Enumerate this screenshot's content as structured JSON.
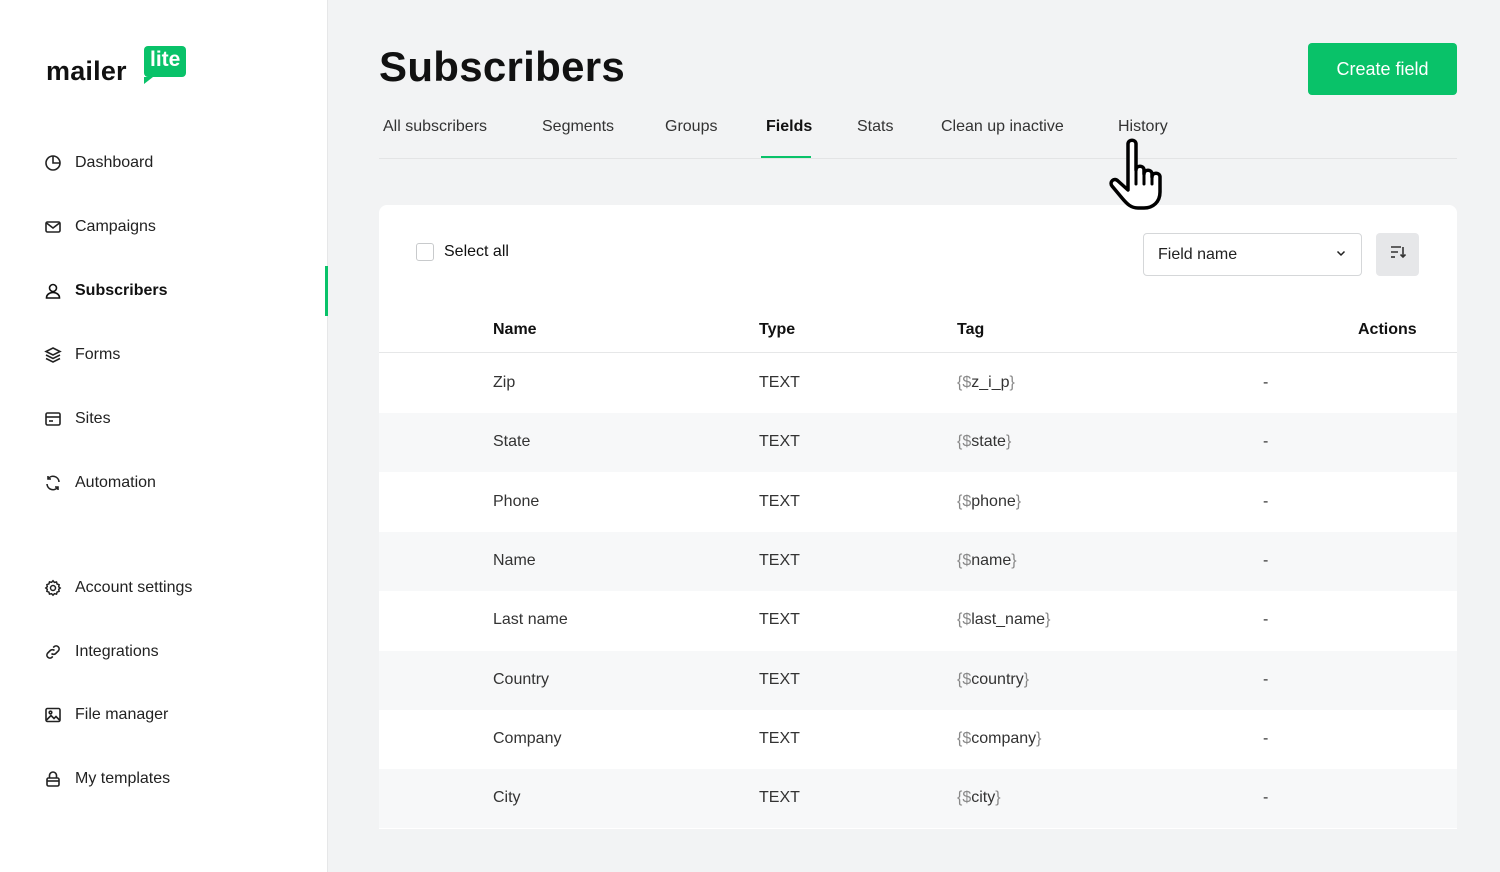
{
  "logo": {
    "part1": "mailer",
    "part2": "lite"
  },
  "sidebar": {
    "items": [
      {
        "label": "Dashboard",
        "icon": "pie-chart-icon"
      },
      {
        "label": "Campaigns",
        "icon": "mail-icon"
      },
      {
        "label": "Subscribers",
        "icon": "user-icon",
        "active": true
      },
      {
        "label": "Forms",
        "icon": "layers-icon"
      },
      {
        "label": "Sites",
        "icon": "browser-icon"
      },
      {
        "label": "Automation",
        "icon": "refresh-icon"
      },
      {
        "label": "Account settings",
        "icon": "gear-icon"
      },
      {
        "label": "Integrations",
        "icon": "link-icon"
      },
      {
        "label": "File manager",
        "icon": "image-icon"
      },
      {
        "label": "My templates",
        "icon": "lock-icon"
      }
    ]
  },
  "header": {
    "title": "Subscribers",
    "create_label": "Create field"
  },
  "tabs": [
    {
      "label": "All subscribers"
    },
    {
      "label": "Segments"
    },
    {
      "label": "Groups"
    },
    {
      "label": "Fields",
      "active": true
    },
    {
      "label": "Stats"
    },
    {
      "label": "Clean up inactive"
    },
    {
      "label": "History"
    }
  ],
  "toolbar": {
    "select_all_label": "Select all",
    "sort_select_value": "Field name"
  },
  "table": {
    "columns": {
      "name": "Name",
      "type": "Type",
      "tag": "Tag",
      "actions": "Actions"
    },
    "rows": [
      {
        "name": "Zip",
        "type": "TEXT",
        "tag_open": "{$",
        "tag": "z_i_p",
        "tag_close": "}",
        "action": "-"
      },
      {
        "name": "State",
        "type": "TEXT",
        "tag_open": "{$",
        "tag": "state",
        "tag_close": "}",
        "action": "-"
      },
      {
        "name": "Phone",
        "type": "TEXT",
        "tag_open": "{$",
        "tag": "phone",
        "tag_close": "}",
        "action": "-"
      },
      {
        "name": "Name",
        "type": "TEXT",
        "tag_open": "{$",
        "tag": "name",
        "tag_close": "}",
        "action": "-"
      },
      {
        "name": "Last name",
        "type": "TEXT",
        "tag_open": "{$",
        "tag": "last_name",
        "tag_close": "}",
        "action": "-"
      },
      {
        "name": "Country",
        "type": "TEXT",
        "tag_open": "{$",
        "tag": "country",
        "tag_close": "}",
        "action": "-"
      },
      {
        "name": "Company",
        "type": "TEXT",
        "tag_open": "{$",
        "tag": "company",
        "tag_close": "}",
        "action": "-"
      },
      {
        "name": "City",
        "type": "TEXT",
        "tag_open": "{$",
        "tag": "city",
        "tag_close": "}",
        "action": "-"
      }
    ]
  },
  "colors": {
    "accent": "#09c269",
    "background": "#f2f3f4"
  }
}
